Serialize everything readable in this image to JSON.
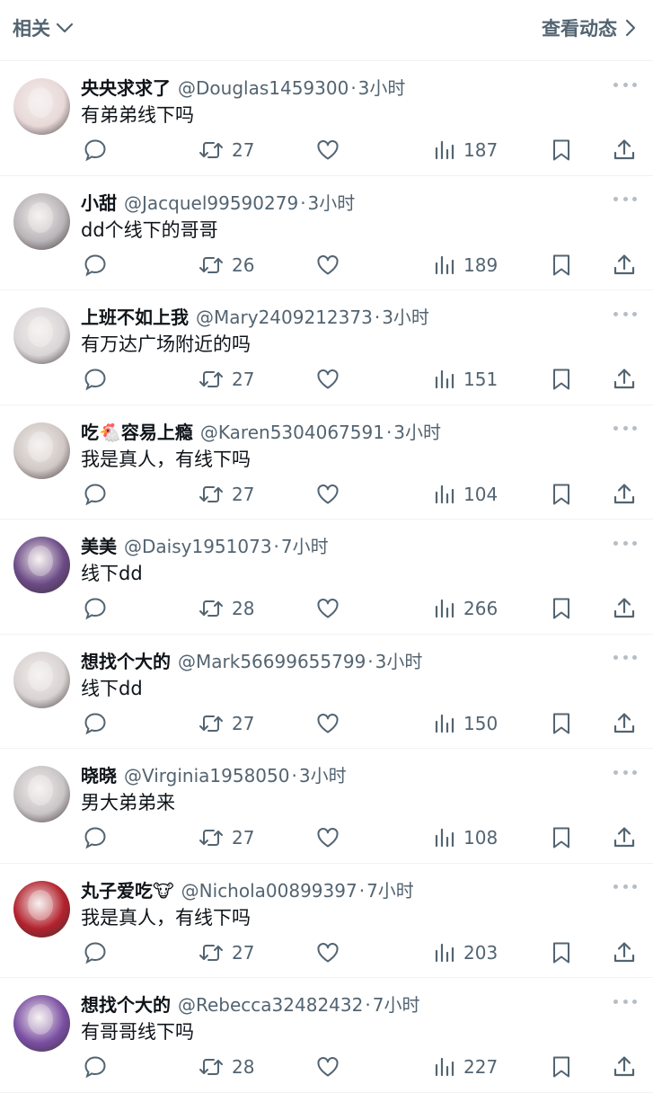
{
  "header": {
    "left_label": "相关",
    "right_label": "查看动态"
  },
  "tweets": [
    {
      "name": "央央求求了",
      "handle": "@Douglas1459300",
      "time": "3小时",
      "text": "有弟弟线下吗",
      "retweets": "27",
      "views": "187",
      "avatar_color": "#e8d9d8"
    },
    {
      "name": "小甜",
      "handle": "@Jacquel99590279",
      "time": "3小时",
      "text": "dd个线下的哥哥",
      "retweets": "26",
      "views": "189",
      "avatar_color": "#b9b5b8"
    },
    {
      "name": "上班不如上我",
      "handle": "@Mary2409212373",
      "time": "3小时",
      "text": "有万达广场附近的吗",
      "retweets": "27",
      "views": "151",
      "avatar_color": "#d9d5d7"
    },
    {
      "name": "吃🐔容易上瘾",
      "handle": "@Karen5304067591",
      "time": "3小时",
      "text": "我是真人，有线下吗",
      "retweets": "27",
      "views": "104",
      "avatar_color": "#cfc8c4"
    },
    {
      "name": "美美",
      "handle": "@Daisy1951073",
      "time": "7小时",
      "text": "线下dd",
      "retweets": "28",
      "views": "266",
      "avatar_color": "#6b4a86"
    },
    {
      "name": "想找个大的",
      "handle": "@Mark56699655799",
      "time": "3小时",
      "text": "线下dd",
      "retweets": "27",
      "views": "150",
      "avatar_color": "#d8d3d2"
    },
    {
      "name": "晓晓",
      "handle": "@Virginia1958050",
      "time": "3小时",
      "text": "男大弟弟来",
      "retweets": "27",
      "views": "108",
      "avatar_color": "#c9c4c6"
    },
    {
      "name": "丸子爱吃🐮",
      "handle": "@Nichola00899397",
      "time": "7小时",
      "text": "我是真人，有线下吗",
      "retweets": "27",
      "views": "203",
      "avatar_color": "#b3222d"
    },
    {
      "name": "想找个大的",
      "handle": "@Rebecca32482432",
      "time": "7小时",
      "text": "有哥哥线下吗",
      "retweets": "28",
      "views": "227",
      "avatar_color": "#7a4fa3"
    }
  ],
  "colors": {
    "secondary_text": "#536471",
    "divider": "#eff3f4",
    "primary_text": "#0f1419"
  }
}
